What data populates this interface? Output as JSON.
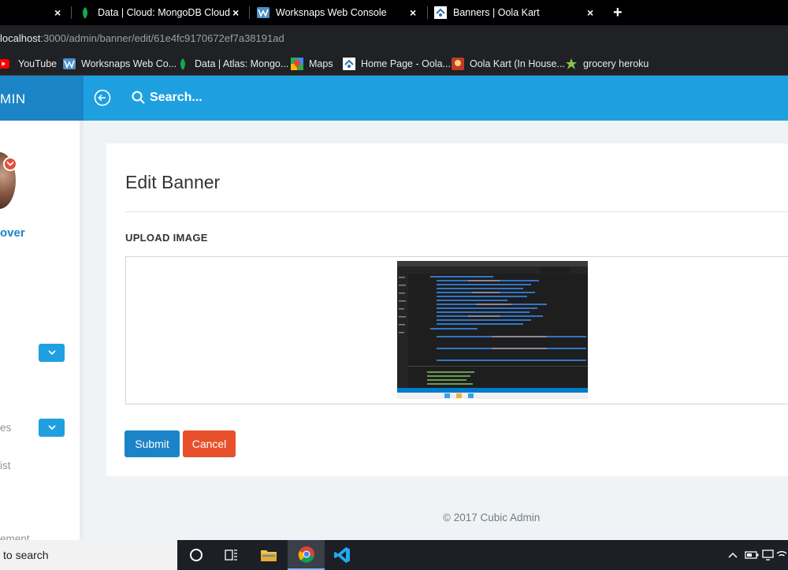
{
  "browser": {
    "tabs": [
      {
        "label": "Data | Cloud: MongoDB Cloud"
      },
      {
        "label": "Worksnaps Web Console"
      },
      {
        "label": "Banners | Oola Kart"
      }
    ],
    "new_tab_symbol": "+",
    "close_symbol": "×",
    "url_host": "localhost",
    "url_path": ":3000/admin/banner/edit/61e4fc9170672ef7a38191ad",
    "bookmarks": [
      {
        "label": "YouTube",
        "icon": "youtube-icon"
      },
      {
        "label": "Worksnaps Web Co...",
        "icon": "worksnaps-icon"
      },
      {
        "label": "Data | Atlas: Mongo...",
        "icon": "mongodb-leaf-icon"
      },
      {
        "label": "Maps",
        "icon": "maps-icon"
      },
      {
        "label": "Home Page - Oola...",
        "icon": "oola-icon"
      },
      {
        "label": "Oola Kart (In House...",
        "icon": "oola-kart-icon"
      },
      {
        "label": "grocery heroku",
        "icon": "heroku-icon"
      }
    ]
  },
  "app": {
    "brand": "MIN",
    "search_placeholder": "Search...",
    "sidebar": {
      "user_name": "over",
      "item_labels": [
        "es",
        "ist",
        "ement"
      ]
    },
    "page_title": "Edit Banner",
    "upload_label": "UPLOAD IMAGE",
    "submit_label": "Submit",
    "cancel_label": "Cancel",
    "footer": "© 2017 Cubic Admin",
    "colors": {
      "header": "#1ea0e0",
      "header_dark": "#1b84c7",
      "submit": "#1b84c7",
      "cancel": "#e8502b"
    }
  },
  "taskbar": {
    "search_text": "to search"
  }
}
